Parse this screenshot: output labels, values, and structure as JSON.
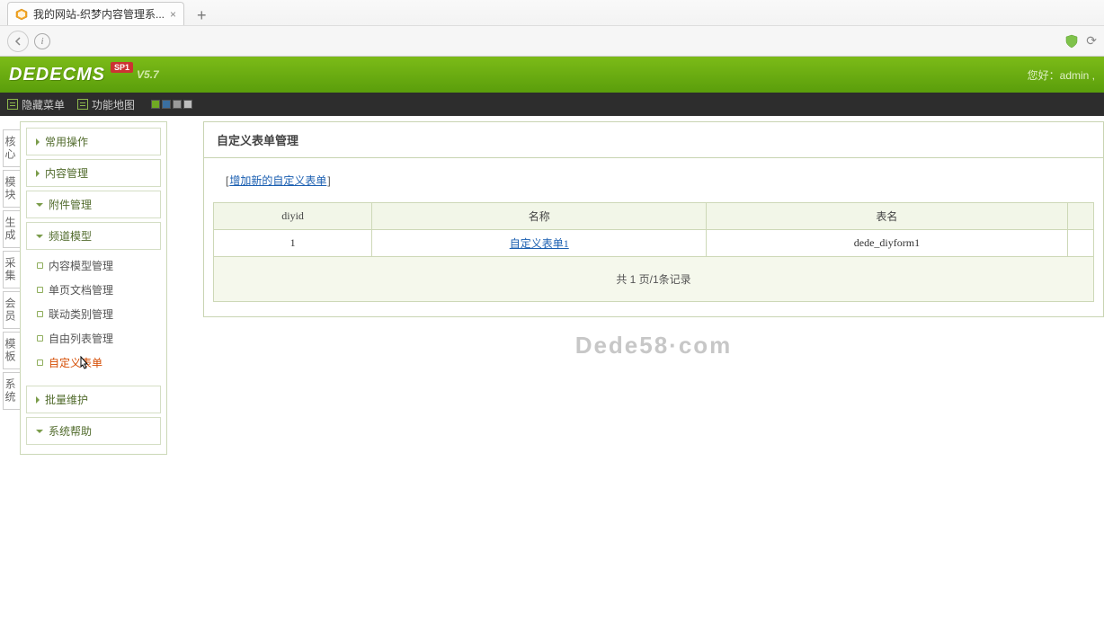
{
  "browser": {
    "tab_title": "我的网站-织梦内容管理系...",
    "url": ""
  },
  "header": {
    "logo_text": "DEDECMS",
    "version": "V5.7",
    "sp_tag": "SP1",
    "greeting": "您好：admin ,"
  },
  "menubar": {
    "hide_menu": "隐藏菜单",
    "function_map": "功能地图",
    "swatches": [
      "#6fa923",
      "#3a6fa0",
      "#9a9a9a",
      "#bdbdbd"
    ]
  },
  "side_tabs": [
    "核心",
    "模块",
    "生成",
    "采集",
    "会员",
    "模板",
    "系统"
  ],
  "nav": {
    "sections": [
      {
        "label": "常用操作",
        "expanded": false
      },
      {
        "label": "内容管理",
        "expanded": false
      },
      {
        "label": "附件管理",
        "expanded": false
      },
      {
        "label": "频道模型",
        "expanded": true,
        "items": [
          {
            "label": "内容模型管理",
            "active": false
          },
          {
            "label": "单页文档管理",
            "active": false
          },
          {
            "label": "联动类别管理",
            "active": false
          },
          {
            "label": "自由列表管理",
            "active": false
          },
          {
            "label": "自定义表单",
            "active": true
          }
        ]
      },
      {
        "label": "批量维护",
        "expanded": false
      },
      {
        "label": "系统帮助",
        "expanded": false
      }
    ]
  },
  "main": {
    "title": "自定义表单管理",
    "add_link": "增加新的自定义表单",
    "columns": {
      "diyid": "diyid",
      "name": "名称",
      "table": "表名"
    },
    "rows": [
      {
        "diyid": "1",
        "name": "自定义表单1",
        "table": "dede_diyform1"
      }
    ],
    "pager": "共 1 页/1条记录",
    "watermark": "Dede58·com"
  }
}
